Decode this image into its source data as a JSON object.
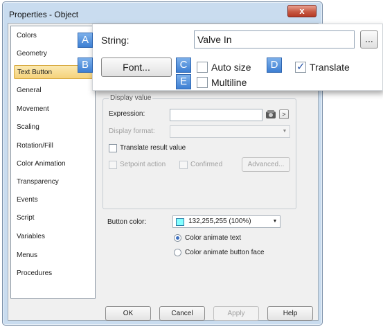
{
  "window": {
    "title": "Properties - Object",
    "close_glyph": "x"
  },
  "sidebar": {
    "items": [
      {
        "label": "Colors"
      },
      {
        "label": "Geometry"
      },
      {
        "label": "Text Button"
      },
      {
        "label": "General"
      },
      {
        "label": "Movement"
      },
      {
        "label": "Scaling"
      },
      {
        "label": "Rotation/Fill"
      },
      {
        "label": "Color Animation"
      },
      {
        "label": "Transparency"
      },
      {
        "label": "Events"
      },
      {
        "label": "Script"
      },
      {
        "label": "Variables"
      },
      {
        "label": "Menus"
      },
      {
        "label": "Procedures"
      }
    ],
    "selected": "Text Button"
  },
  "display_value": {
    "group_title": "Display value",
    "expression_label": "Expression:",
    "expression_value": "",
    "display_format_label": "Display format:",
    "display_format_value": "",
    "translate_result_label": "Translate result value",
    "setpoint_label": "Setpoint action",
    "confirmed_label": "Confirmed",
    "advanced_label": "Advanced...",
    "arrow_glyph": ">"
  },
  "button_color": {
    "label": "Button color:",
    "value": "132,255,255 (100%)",
    "swatch_color": "#84ffff",
    "animate_text_label": "Color animate text",
    "animate_face_label": "Color animate button face",
    "selected": "Color animate text"
  },
  "footer": {
    "ok": "OK",
    "cancel": "Cancel",
    "apply": "Apply",
    "help": "Help"
  },
  "overlay": {
    "tags": [
      "A",
      "B",
      "C",
      "D",
      "E"
    ],
    "string_label": "String:",
    "string_value": "Valve In",
    "ellipsis": "...",
    "font_button": "Font...",
    "auto_size_label": "Auto size",
    "auto_size_checked": false,
    "translate_label": "Translate",
    "translate_checked": true,
    "multiline_label": "Multiline",
    "multiline_checked": false
  },
  "colors": {
    "accent_tag": "#3d7fd3",
    "selection": "#f5d27a",
    "close_button": "#c75a44"
  }
}
